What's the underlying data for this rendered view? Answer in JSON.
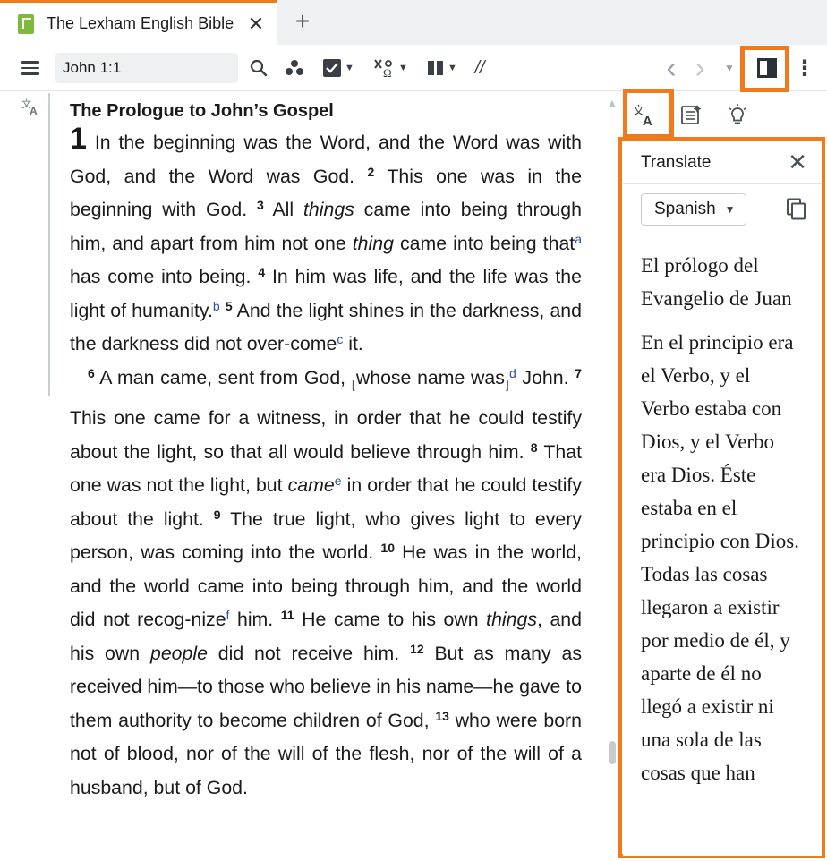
{
  "tab": {
    "title": "The Lexham English Bible",
    "close": "✕",
    "add": "+"
  },
  "toolbar": {
    "reference_value": "John 1:1",
    "nav_back": "‹",
    "nav_forward": "›",
    "parallel_icon_label": "//",
    "more": "⋮"
  },
  "text": {
    "heading": "The Prologue to John’s Gospel",
    "chapter": "1",
    "p1": {
      "v1": " In the beginning was the Word, and the Word was with God, and the Word was God. ",
      "n2": "2",
      "v2": " This one was in the beginning with God. ",
      "n3": "3",
      "v3a": " All ",
      "v3_things": "things",
      "v3b": " came into being through him, and apart from him not one ",
      "v3_thing": "thing",
      "v3c": " came into being that",
      "fa": "a",
      "v3d": " has come into being. ",
      "n4": "4",
      "v4": " In him was life, and the life was the light of humanity.",
      "fb": "b",
      "n5": "5",
      "v5a": " And the light shines in the darkness, and the darkness did not over-come",
      "fc": "c",
      "v5b": " it."
    },
    "p2": {
      "n6": "6",
      "v6a": " A man came, sent from God, ",
      "bk_open": "⌊",
      "v6_phrase": "whose name was",
      "bk_close": "⌋",
      "fd": "d",
      "v6b": " John. ",
      "n7": "7",
      "v7": " This one came for a witness, in order that he could testify about the light, so that all would believe through him. ",
      "n8": "8",
      "v8a": " That one was not the light, but ",
      "v8_came": "came",
      "fe": "e",
      "v8b": " in order that he could testify about the light. ",
      "n9": "9",
      "v9": " The true light, who gives light to every person, was coming into the world. ",
      "n10": "10",
      "v10a": " He was in the world, and the world came into being through him, and the world did not recog-nize",
      "ff": "f",
      "v10b": " him. ",
      "n11": "11",
      "v11a": " He came to his own ",
      "v11_things": "things",
      "v11b": ", and his own ",
      "v11_people": "people",
      "v11c": " did not receive him. ",
      "n12": "12",
      "v12": " But as many as received him—to those who believe in his name—he gave to them authority to become children of God, ",
      "n13": "13",
      "v13": " who were born not of blood, nor of the will of the flesh, nor of the will of a husband, but of God."
    }
  },
  "panel": {
    "title": "Translate",
    "close": "✕",
    "language": "Spanish",
    "translated_heading": "El prólogo del Evangelio de Juan",
    "translated_body": "En el principio era el Verbo, y el Verbo estaba con Dios, y el Verbo era Dios. Éste estaba en el principio con Dios. Todas las cosas llegaron a existir por medio de él, y aparte de él no llegó a existir ni una sola de las cosas que han"
  },
  "colors": {
    "accent": "#f07a1c",
    "footnote": "#2f4fb0",
    "app_icon": "#7dba3c"
  },
  "icons": [
    "app-logo-icon",
    "close-icon",
    "plus-icon",
    "hamburger-icon",
    "search-icon",
    "cluster-icon",
    "checklist-icon",
    "interlinear-icon",
    "columns-icon",
    "parallel-icon",
    "back-arrow-icon",
    "forward-arrow-icon",
    "split-panel-icon",
    "more-icon",
    "translate-icon",
    "notes-icon",
    "lightbulb-icon",
    "copy-icon"
  ]
}
